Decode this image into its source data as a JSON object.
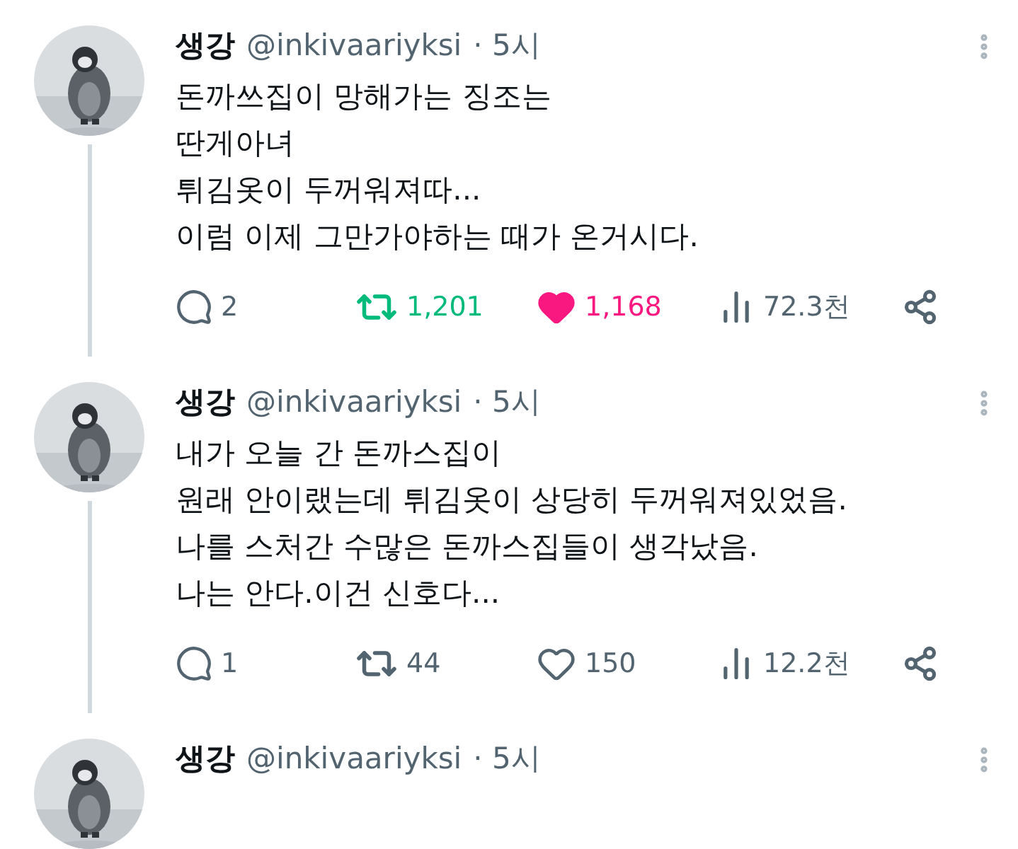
{
  "tweets": [
    {
      "name": "생강",
      "handle": "@inkivaariyksi",
      "time": "· 5시",
      "thread_line": true,
      "lines": [
        "돈까쓰집이 망해가는 징조는",
        "딴게아녀",
        "튀김옷이 두꺼워져따...",
        "이럼 이제 그만가야하는 때가 온거시다."
      ],
      "replies": "2",
      "retweets": "1,201",
      "retweeted": true,
      "likes": "1,168",
      "liked": true,
      "views": "72.3천"
    },
    {
      "name": "생강",
      "handle": "@inkivaariyksi",
      "time": "· 5시",
      "thread_line": true,
      "lines": [
        "내가 오늘 간 돈까스집이",
        "원래 안이랬는데 튀김옷이 상당히 두꺼워져있었음.",
        "나를 스처간 수많은 돈까스집들이 생각났음.",
        "나는 안다.이건 신호다..."
      ],
      "replies": "1",
      "retweets": "44",
      "retweeted": false,
      "likes": "150",
      "liked": false,
      "views": "12.2천"
    },
    {
      "name": "생강",
      "handle": "@inkivaariyksi",
      "time": "· 5시",
      "thread_line": false
    }
  ]
}
